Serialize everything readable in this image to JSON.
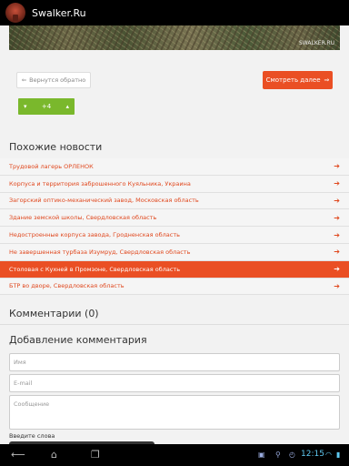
{
  "app": {
    "title": "Swalker.Ru"
  },
  "photo": {
    "watermark": "SWALKER.RU"
  },
  "buttons": {
    "back": "Вернутся обратно",
    "next": "Смотреть далее"
  },
  "likes": {
    "count": "+4"
  },
  "related": {
    "title": "Похожие новости",
    "items": [
      "Трудовой лагерь ОРЛЕНОК",
      "Корпуса и территория заброшенного Куяльника, Украина",
      "Загорский оптико-механический завод, Московская область",
      "Здание земской школы, Свердловская область",
      "Недостроенные корпуса завода, Гродненская область",
      "Не завершенная турбаза Изумруд, Свердловская область",
      "Столовая с Кухней в Промзоне, Свердловская область",
      "БТР во дворе, Свердловская область"
    ],
    "active_index": 6
  },
  "comments": {
    "title": "Комментарии (0)"
  },
  "add_comment": {
    "title": "Добавление комментария",
    "name_placeholder": "Имя",
    "email_placeholder": "E-mail",
    "message_placeholder": "Сообщение",
    "captcha_label": "Введите слова"
  },
  "status": {
    "time": "12:15"
  },
  "colors": {
    "accent": "#ea4f24",
    "link": "#e0481e",
    "like": "#7ab82c"
  }
}
